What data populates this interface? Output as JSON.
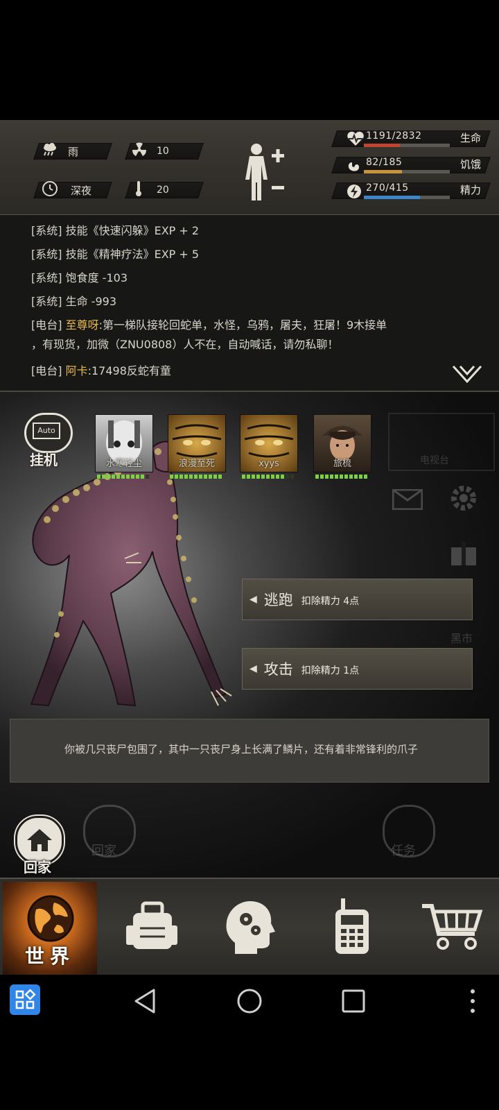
{
  "status": {
    "weather": {
      "icon": "rain-cloud-icon",
      "label": "雨"
    },
    "radiation": {
      "icon": "radiation-icon",
      "value": "10"
    },
    "time": {
      "icon": "clock-icon",
      "label": "深夜"
    },
    "temperature": {
      "icon": "thermometer-icon",
      "value": "20"
    },
    "body_icon": "body-figure-icon",
    "bars": [
      {
        "icon": "heart-rate-icon",
        "value": "1191/2832",
        "label": "生命",
        "fill": 0.42,
        "color": "#c4452f"
      },
      {
        "icon": "stomach-icon",
        "value": "82/185",
        "label": "饥饿",
        "fill": 0.44,
        "color": "#c8943a"
      },
      {
        "icon": "lightning-icon",
        "value": "270/415",
        "label": "精力",
        "fill": 0.65,
        "color": "#3f86c9"
      }
    ]
  },
  "log": [
    {
      "tag": "[系统]",
      "highlight": "",
      "text": "技能《快速闪躲》EXP + 2"
    },
    {
      "tag": "[系统]",
      "highlight": "",
      "text": "技能《精神疗法》EXP + 5"
    },
    {
      "tag": "[系统]",
      "highlight": "",
      "text": "饱食度 -103"
    },
    {
      "tag": "[系统]",
      "highlight": "",
      "text": "生命 -993"
    },
    {
      "tag": "[电台]",
      "highlight": "至尊呀",
      "text": ":第一梯队接轮回蛇单，水怪，乌鸦，屠夫，狂屠！9木接单"
    },
    {
      "tag": "",
      "highlight": "",
      "text": "，有现货，加微（ZNU0808）人不在，自动喊话，请勿私聊！"
    },
    {
      "tag": "[电台]",
      "highlight": "阿卡",
      "text": ":17498反蛇有童"
    }
  ],
  "auto_button": {
    "badge": "Auto",
    "label": "挂机"
  },
  "party": [
    {
      "name": "水寒轻尘",
      "hp": 0.95
    },
    {
      "name": "浪漫至死",
      "hp": 1.0
    },
    {
      "name": "xyys",
      "hp": 0.8
    },
    {
      "name": "旅梳",
      "hp": 1.0
    }
  ],
  "side_faded": {
    "tv": "电视台",
    "market": "黑市",
    "home": "回家",
    "task": "任务"
  },
  "actions": [
    {
      "label": "逃跑",
      "cost": "扣除精力 4点"
    },
    {
      "label": "攻击",
      "cost": "扣除精力 1点"
    }
  ],
  "message": "你被几只丧尸包围了，其中一只丧尸身上长满了鳞片，还有着非常锋利的爪子",
  "home_button": {
    "label": "回家"
  },
  "tabs": {
    "world": "世界"
  }
}
